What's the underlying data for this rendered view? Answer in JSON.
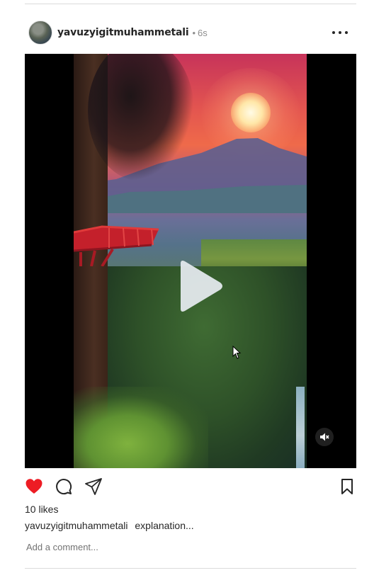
{
  "post": {
    "username": "yavuzyigitmuhammetali",
    "separator": "•",
    "time": "6s",
    "likes": "10 likes",
    "caption_user": "yavuzyigitmuhammetali",
    "caption_text": "explanation..."
  },
  "comment": {
    "placeholder": "Add a comment..."
  },
  "icons": {
    "more": "more-icon",
    "play": "play-icon",
    "mute": "volume-muted-icon",
    "like": "heart-filled-icon",
    "comment": "comment-icon",
    "share": "share-icon",
    "save": "bookmark-icon"
  },
  "colors": {
    "like_active": "#ed1c24",
    "text_primary": "#262626",
    "text_secondary": "#8e8e8e",
    "divider": "#dbdbdb"
  }
}
